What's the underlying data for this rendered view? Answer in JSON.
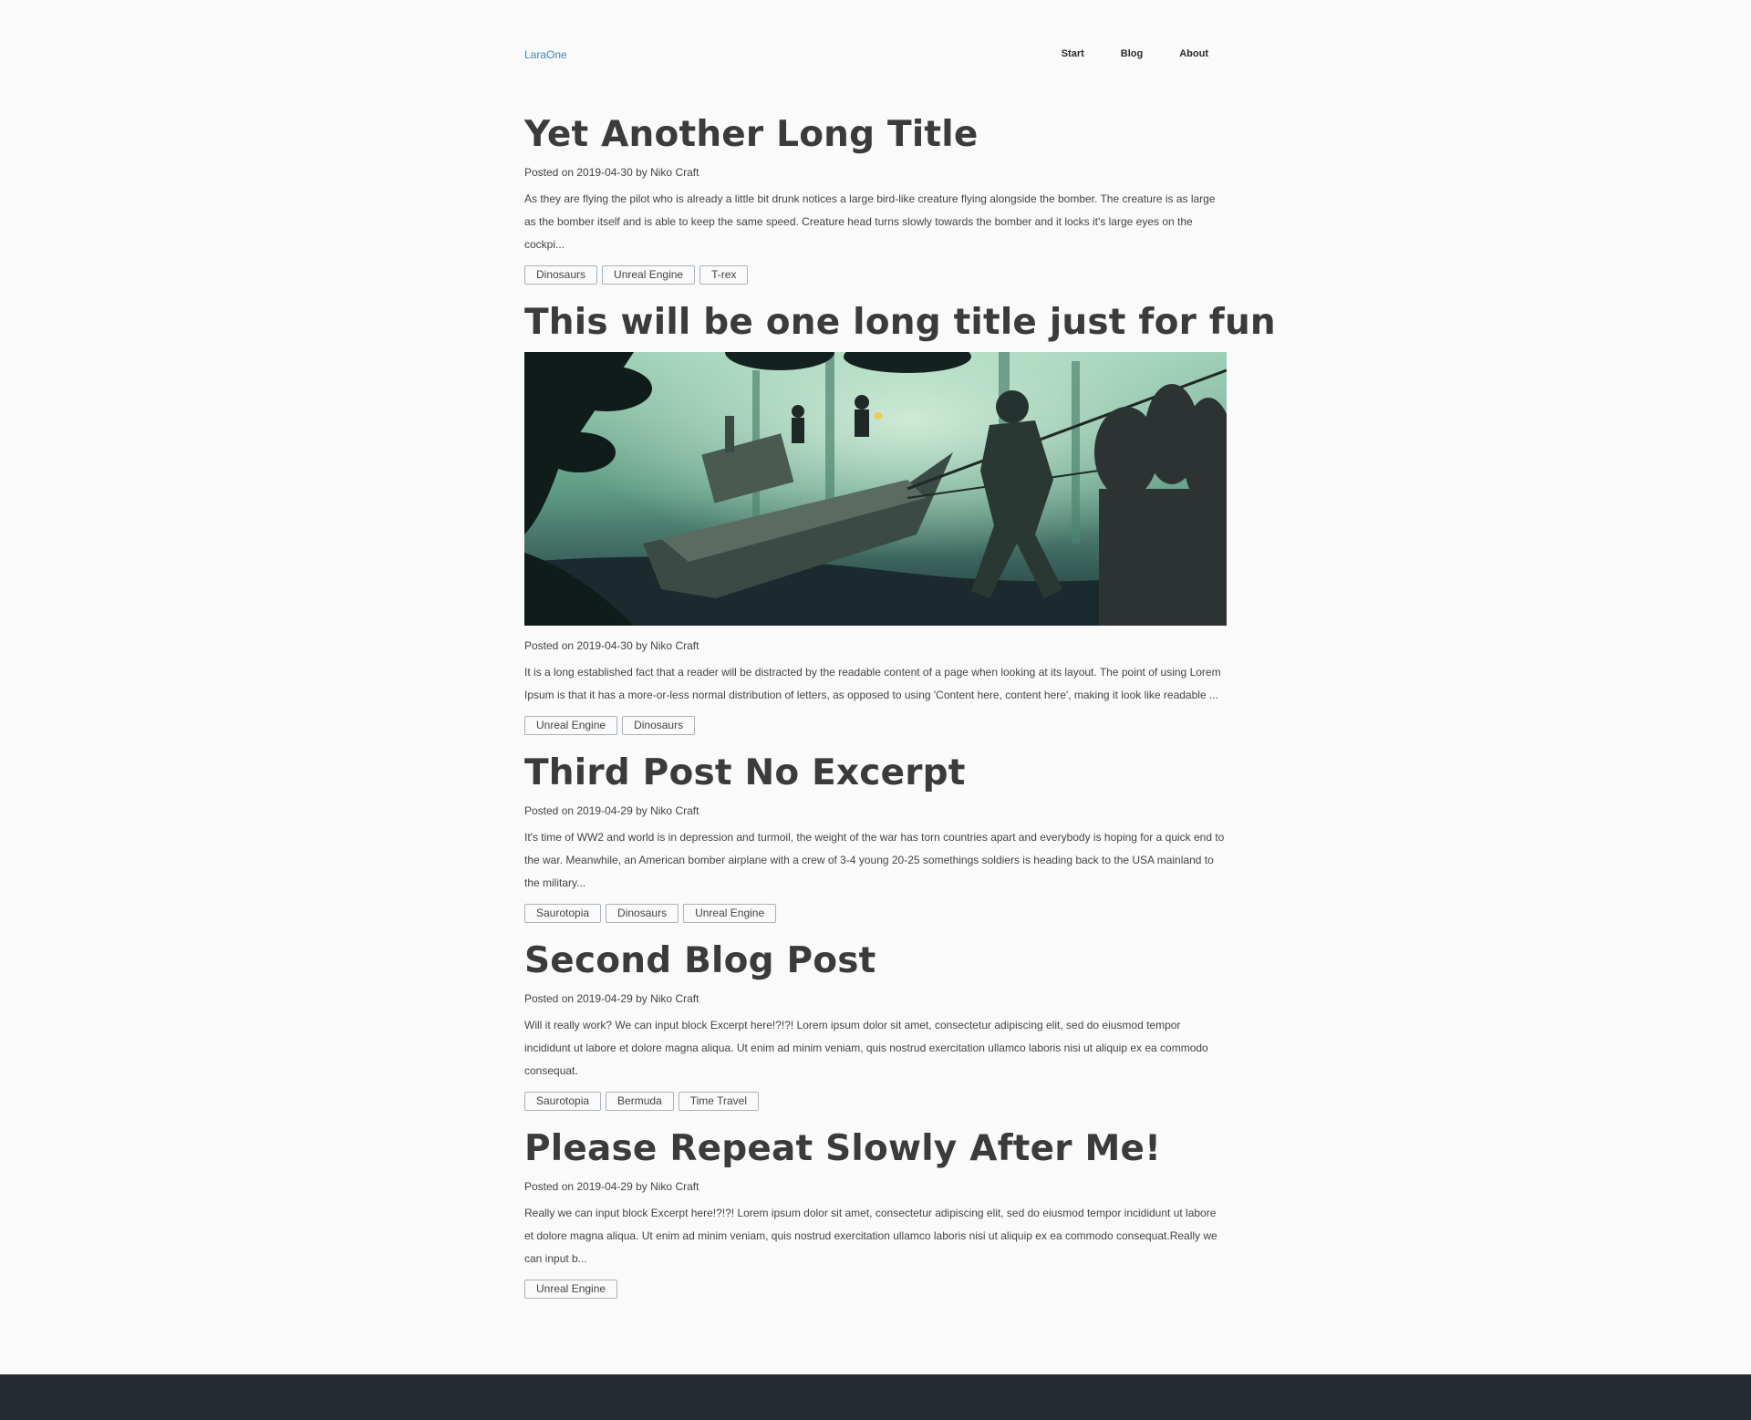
{
  "header": {
    "brand": "LaraOne",
    "nav": [
      {
        "label": "Start"
      },
      {
        "label": "Blog"
      },
      {
        "label": "About"
      }
    ]
  },
  "posts": [
    {
      "title": "Yet Another Long Title",
      "meta": "Posted on 2019-04-30 by Niko Craft",
      "excerpt": "As they are flying the pilot who is already a little bit drunk notices a large bird-like creature flying alongside the bomber. The creature is as large as the bomber itself and is able to keep the same speed. Creature head turns slowly towards the bomber and it locks it's large eyes on the cockpi...",
      "tags": [
        "Dinosaurs",
        "Unreal Engine",
        "T-rex"
      ]
    },
    {
      "title": "This will be one long title just for fun",
      "meta": "Posted on 2019-04-30 by Niko Craft",
      "excerpt": "It is a long established fact that a reader will be distracted by the readable content of a page when looking at its layout. The point of using Lorem Ipsum is that it has a more-or-less normal distribution of letters, as opposed to using 'Content here, content here', making it look like readable ...",
      "tags": [
        "Unreal Engine",
        "Dinosaurs"
      ]
    },
    {
      "title": "Third Post No Excerpt",
      "meta": "Posted on 2019-04-29 by Niko Craft",
      "excerpt": "It's time of WW2 and world is in depression and turmoil, the weight of the war has torn countries apart and everybody is hoping for a quick end to the war. Meanwhile, an American bomber airplane with a crew of 3-4 young 20-25 somethings soldiers is heading back to the USA mainland to the military...",
      "tags": [
        "Saurotopia",
        "Dinosaurs",
        "Unreal Engine"
      ]
    },
    {
      "title": "Second Blog Post",
      "meta": "Posted on 2019-04-29 by Niko Craft",
      "excerpt": "Will it really work? We can input block Excerpt here!?!?! Lorem ipsum dolor sit amet, consectetur adipiscing elit, sed do eiusmod tempor incididunt ut labore et dolore magna aliqua. Ut enim ad minim veniam, quis nostrud exercitation ullamco laboris nisi ut aliquip ex ea commodo consequat.",
      "tags": [
        "Saurotopia",
        "Bermuda",
        "Time Travel"
      ]
    },
    {
      "title": "Please Repeat Slowly After Me!",
      "meta": "Posted on 2019-04-29 by Niko Craft",
      "excerpt": "Really we can input block Excerpt here!?!?! Lorem ipsum dolor sit amet, consectetur adipiscing elit, sed do eiusmod tempor incididunt ut labore et dolore magna aliqua. Ut enim ad minim veniam, quis nostrud exercitation ullamco laboris nisi ut aliquip ex ea commodo consequat.Really we can input b...",
      "tags": [
        "Unreal Engine"
      ]
    }
  ],
  "colors": {
    "brand": "#3d87c0",
    "footer": "#252b31",
    "background": "#fafafa"
  }
}
